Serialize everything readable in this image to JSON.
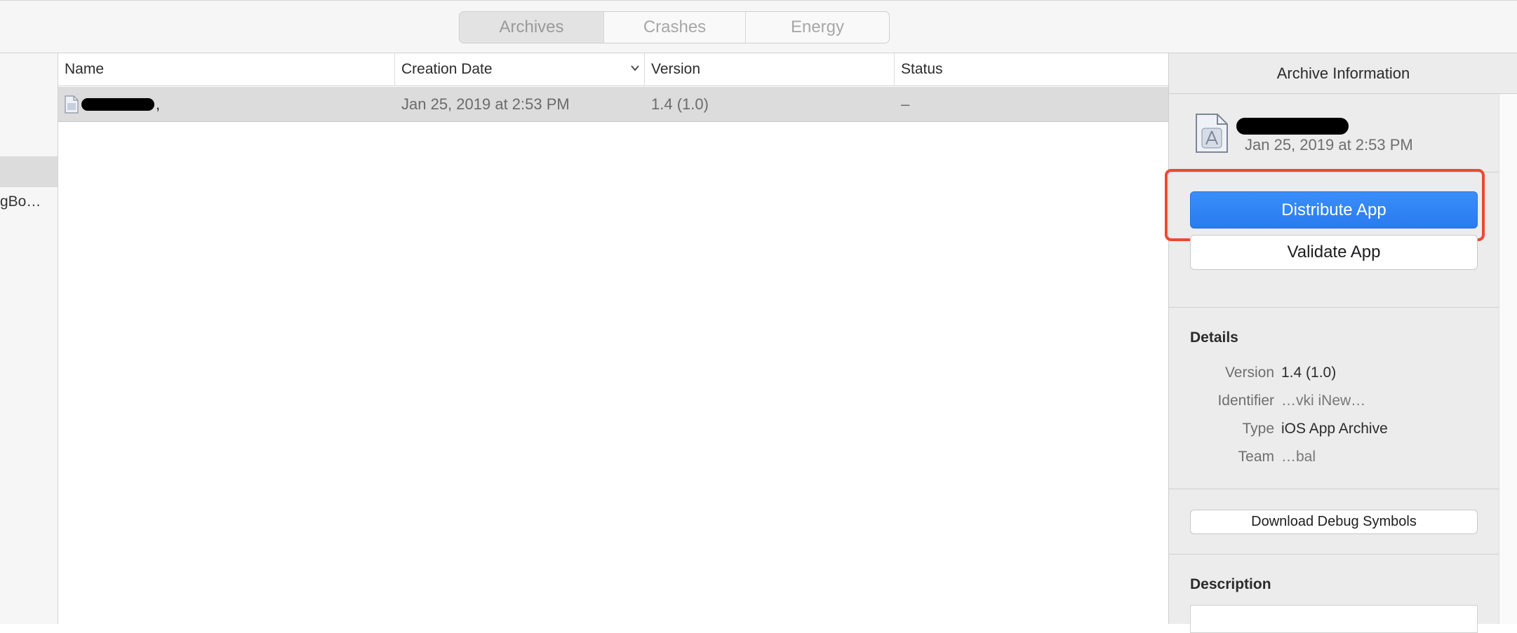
{
  "tabs": [
    "Archives",
    "Crashes",
    "Energy"
  ],
  "active_tab": "Archives",
  "sidebar": {
    "items": [
      {
        "label": "gBo…"
      }
    ]
  },
  "table": {
    "columns": [
      "Name",
      "Creation Date",
      "Version",
      "Status"
    ],
    "sort_column": "Creation Date",
    "sort_direction": "descending",
    "rows": [
      {
        "name_suffix": ",",
        "creation_date": "Jan 25, 2019 at 2:53 PM",
        "version": "1.4 (1.0)",
        "status": "–"
      }
    ]
  },
  "inspector": {
    "header": "Archive Information",
    "archive_date": "Jan 25, 2019 at 2:53 PM",
    "distribute_label": "Distribute App",
    "validate_label": "Validate App",
    "details_title": "Details",
    "details": [
      {
        "key": "Version",
        "value": "1.4 (1.0)"
      },
      {
        "key": "Identifier",
        "value": "…vki iNew…"
      },
      {
        "key": "Type",
        "value": "iOS App Archive"
      },
      {
        "key": "Team",
        "value": "…bal"
      }
    ],
    "download_label": "Download Debug Symbols",
    "description_title": "Description"
  },
  "colors": {
    "accent": "#2a7bf0",
    "highlight": "#ec4a30",
    "selected_row": "#dcdcdc"
  }
}
